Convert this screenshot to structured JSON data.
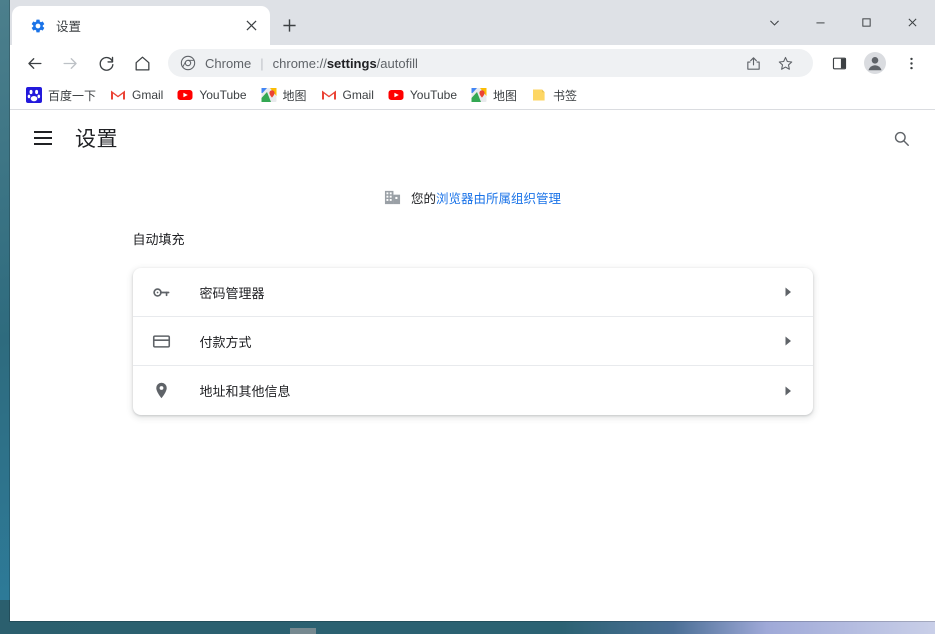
{
  "window": {
    "controls": [
      {
        "name": "tab-search-button",
        "glyph": "chevron-down-icon"
      },
      {
        "name": "minimize-button",
        "glyph": "minimize-icon"
      },
      {
        "name": "maximize-button",
        "glyph": "maximize-icon"
      },
      {
        "name": "close-window-button",
        "glyph": "close-icon"
      }
    ]
  },
  "tab": {
    "title": "设置",
    "favicon": "gear-icon",
    "close_label": "×",
    "new_tab_label": "+"
  },
  "toolbar": {
    "back": "back-arrow-icon",
    "forward": "forward-arrow-icon",
    "reload": "reload-icon",
    "home": "home-icon",
    "omnibox": {
      "chip_label": "Chrome",
      "separator": "|",
      "url_prefix": "chrome://",
      "url_bold": "settings",
      "url_suffix": "/autofill",
      "logo": "chrome-logo-icon"
    },
    "share": "share-icon",
    "bookmark_star": "star-icon",
    "side_panel": "side-panel-icon",
    "profile": "profile-avatar-icon",
    "menu": "three-dot-menu-icon"
  },
  "bookmarks": [
    {
      "label": "百度一下",
      "icon": "baidu-icon"
    },
    {
      "label": "Gmail",
      "icon": "gmail-icon"
    },
    {
      "label": "YouTube",
      "icon": "youtube-icon"
    },
    {
      "label": "地图",
      "icon": "maps-icon"
    },
    {
      "label": "Gmail",
      "icon": "gmail-icon"
    },
    {
      "label": "YouTube",
      "icon": "youtube-icon"
    },
    {
      "label": "地图",
      "icon": "maps-icon"
    },
    {
      "label": "书签",
      "icon": "folder-icon"
    }
  ],
  "settings": {
    "menu_button": "hamburger-menu-icon",
    "title": "设置",
    "search_icon": "search-icon",
    "managed_banner": {
      "icon": "enterprise-building-icon",
      "prefix": "您的",
      "link": "浏览器由所属组织管理"
    },
    "section_title": "自动填充",
    "rows": [
      {
        "label": "密码管理器",
        "icon": "key-icon",
        "arrow": "chevron-right-icon"
      },
      {
        "label": "付款方式",
        "icon": "credit-card-icon",
        "arrow": "chevron-right-icon"
      },
      {
        "label": "地址和其他信息",
        "icon": "location-pin-icon",
        "arrow": "chevron-right-icon"
      }
    ]
  },
  "colors": {
    "accent": "#1a73e8",
    "tabstrip": "#dee1e6",
    "omnibox_bg": "#eff1f3",
    "text_primary": "#202124",
    "text_secondary": "#5f6368"
  }
}
